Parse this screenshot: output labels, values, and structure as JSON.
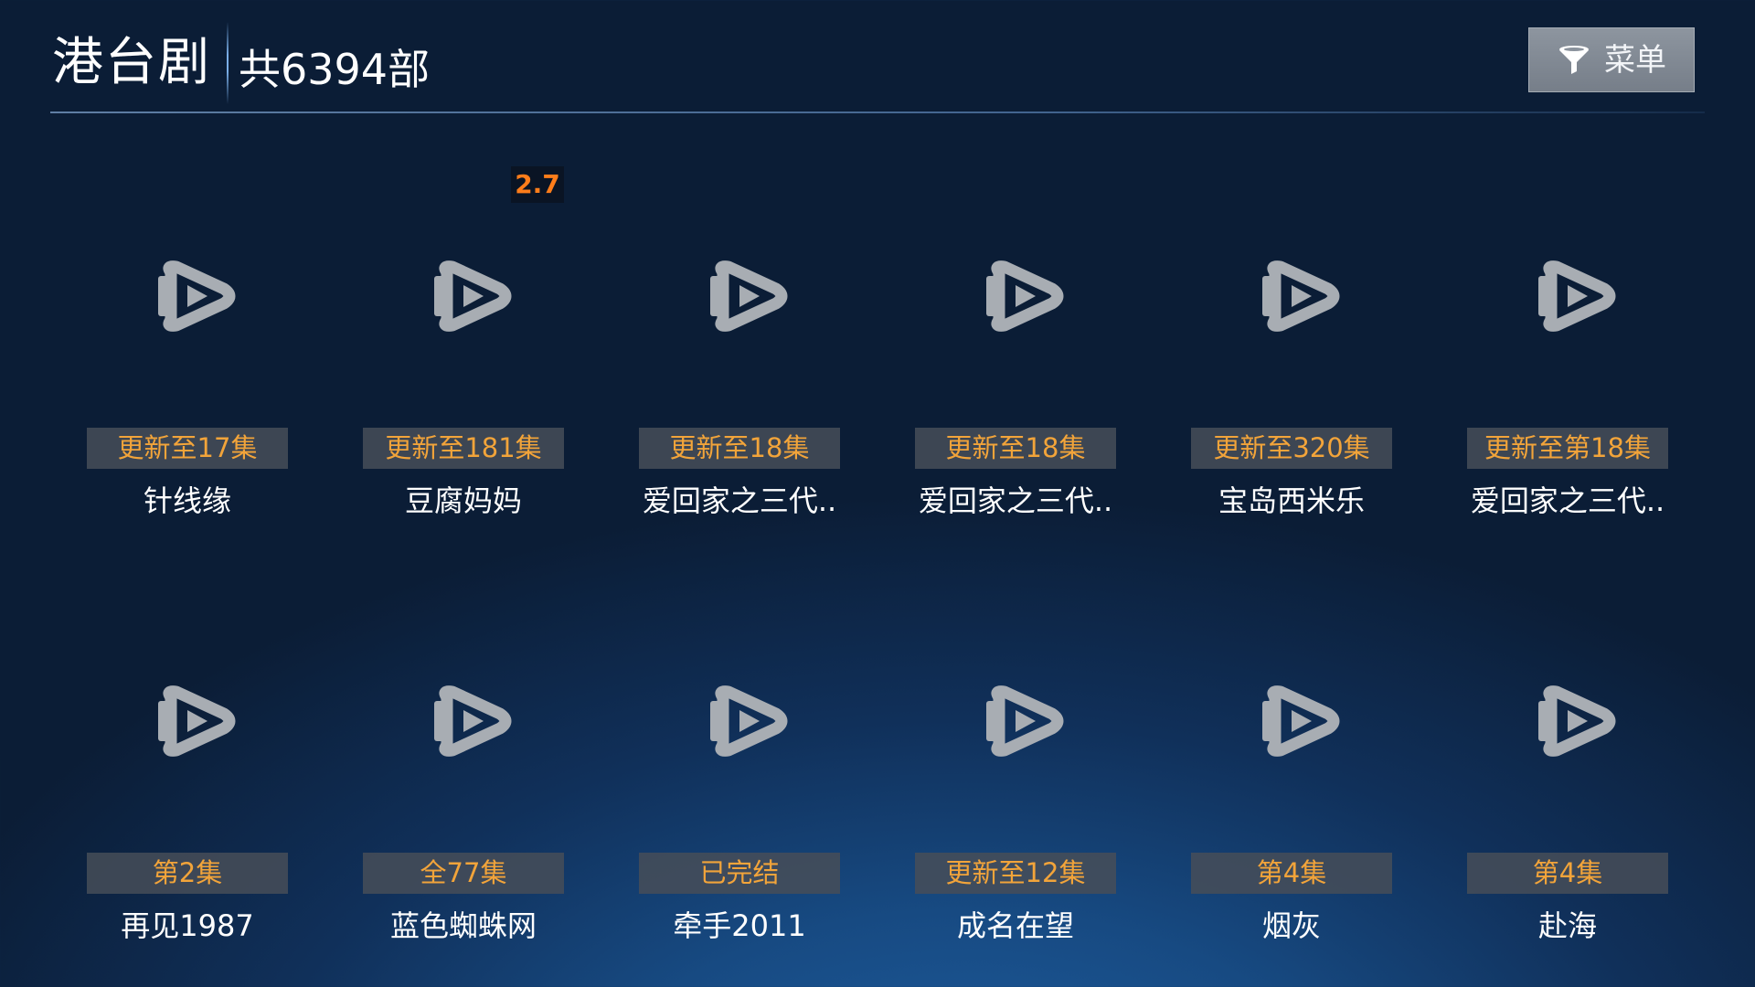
{
  "header": {
    "category_title": "港台剧",
    "total_count": "共6394部",
    "menu_label": "菜单",
    "menu_icon": "filter-icon"
  },
  "colors": {
    "status_text": "#f2a43a",
    "rating_text": "#ff7d1a",
    "title_text": "#ffffff"
  },
  "items": [
    {
      "status": "更新至17集",
      "title": "针线缘",
      "rating": "",
      "icon": "play-icon"
    },
    {
      "status": "更新至181集",
      "title": "豆腐妈妈",
      "rating": "2.7",
      "icon": "play-icon"
    },
    {
      "status": "更新至18集",
      "title": "爱回家之三代..",
      "rating": "",
      "icon": "play-icon"
    },
    {
      "status": "更新至18集",
      "title": "爱回家之三代..",
      "rating": "",
      "icon": "play-icon"
    },
    {
      "status": "更新至320集",
      "title": "宝岛西米乐",
      "rating": "",
      "icon": "play-icon"
    },
    {
      "status": "更新至第18集",
      "title": "爱回家之三代..",
      "rating": "",
      "icon": "play-icon"
    },
    {
      "status": "第2集",
      "title": "再见1987",
      "rating": "",
      "icon": "play-icon"
    },
    {
      "status": "全77集",
      "title": "蓝色蜘蛛网",
      "rating": "",
      "icon": "play-icon"
    },
    {
      "status": "已完结",
      "title": "牵手2011",
      "rating": "",
      "icon": "play-icon"
    },
    {
      "status": "更新至12集",
      "title": "成名在望",
      "rating": "",
      "icon": "play-icon"
    },
    {
      "status": "第4集",
      "title": "烟灰",
      "rating": "",
      "icon": "play-icon"
    },
    {
      "status": "第4集",
      "title": "赴海",
      "rating": "",
      "icon": "play-icon"
    }
  ]
}
